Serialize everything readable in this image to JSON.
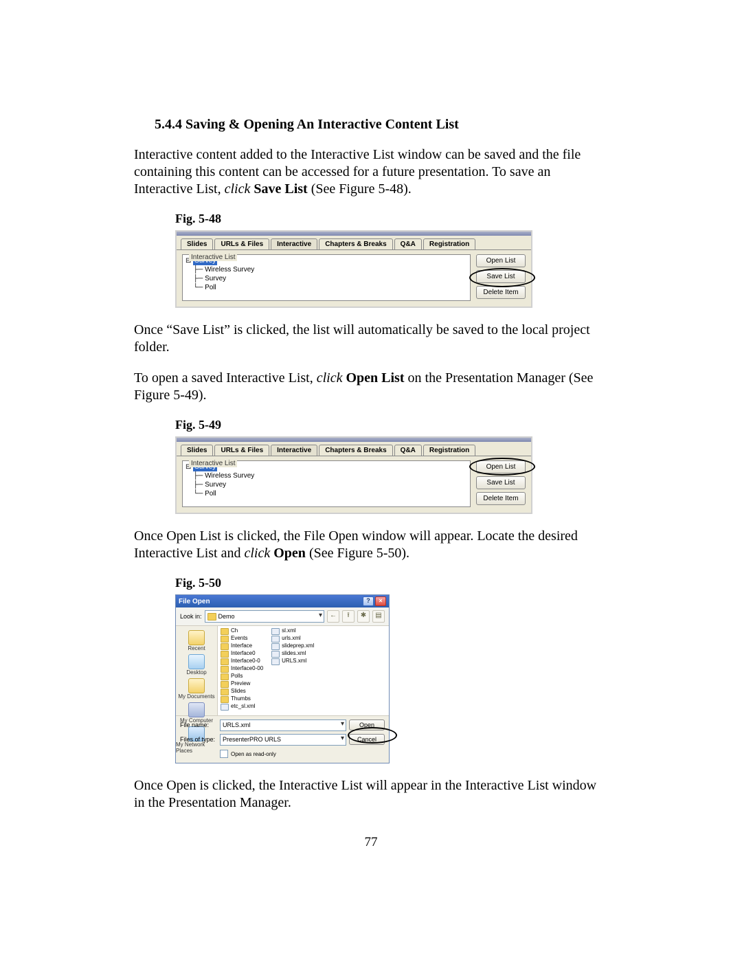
{
  "heading": "5.4.4  Saving & Opening An Interactive Content List",
  "para1_a": "Interactive content added to the Interactive List window can be saved and the file containing this content can be accessed for a future presentation.  To save an Interactive List,  ",
  "para1_click": "click",
  "para1_b": " ",
  "para1_bold": "Save List",
  "para1_c": " (See Figure 5-48).",
  "fig48": "Fig. 5-48",
  "para2": "Once “Save List” is clicked, the list will automatically be saved to the local project folder.",
  "para3_a": "To open a saved Interactive List, ",
  "para3_click": "click",
  "para3_b": " ",
  "para3_bold": "Open List",
  "para3_c": " on the Presentation Manager (See Figure 5-49).",
  "fig49": "Fig. 5-49",
  "para4_a": "Once Open List is clicked, the File Open window will appear.  Locate the desired Interactive List and ",
  "para4_click": "click",
  "para4_b": " ",
  "para4_bold": "Open",
  "para4_c": " (See Figure 5-50).",
  "fig50": "Fig. 5-50",
  "para5": "Once Open is clicked, the Interactive List will appear in the Interactive List window in the Presentation Manager.",
  "page_number": "77",
  "tabs": {
    "slides": "Slides",
    "urls": "URLs & Files",
    "interactive": "Interactive",
    "chapters": "Chapters & Breaks",
    "qa": "Q&A",
    "registration": "Registration"
  },
  "tree_group_label": "Interactive List",
  "tree": {
    "root": "Survey",
    "child1": "Wireless Survey",
    "child2": "Survey",
    "child3": "Poll"
  },
  "buttons": {
    "open_list": "Open List",
    "save_list": "Save List",
    "delete_item": "Delete Item"
  },
  "file_open": {
    "title": "File Open",
    "lookin_label": "Look in:",
    "lookin_value": "Demo",
    "places": {
      "recent": "Recent",
      "desktop": "Desktop",
      "mydocs": "My Documents",
      "mycomp": "My Computer",
      "mynet": "My Network Places"
    },
    "folders": [
      "Ch",
      "Events",
      "Interface",
      "Interface0",
      "Interface0-0",
      "Interface0-00",
      "Polls",
      "Preview",
      "Slides",
      "Thumbs"
    ],
    "files_left": [
      "etc_sl.xml",
      "sl.xml",
      "urls.xml"
    ],
    "files_right": [
      "slideprep.xml",
      "slides.xml",
      "URLS.xml"
    ],
    "filename_label": "File name:",
    "filename_value": "URLS.xml",
    "filesoftype_label": "Files of type:",
    "filesoftype_value": "PresenterPRO URLS",
    "readonly_label": "Open as read-only",
    "open_btn": "Open",
    "cancel_btn": "Cancel"
  }
}
